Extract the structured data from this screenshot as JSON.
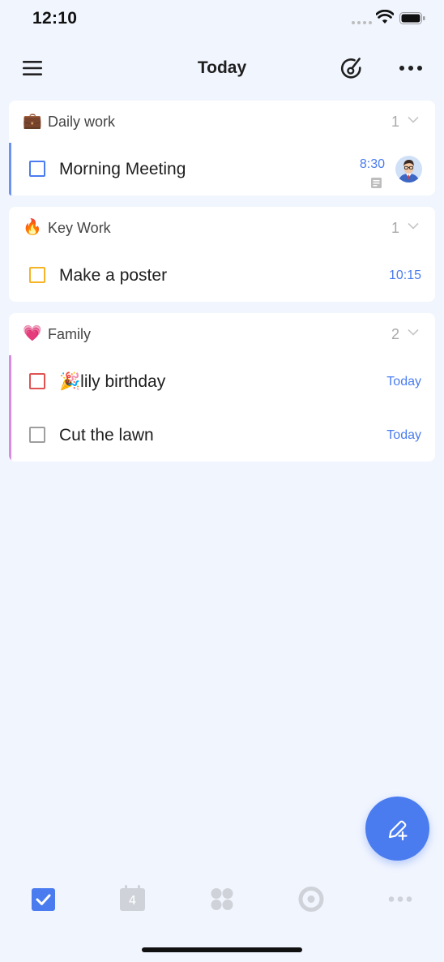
{
  "status_bar": {
    "time": "12:10"
  },
  "header": {
    "title": "Today"
  },
  "colors": {
    "accent": "#4a7cf0",
    "daily_bar": "#6e93ee",
    "key_checkbox": "#f5b325",
    "family_bar": "#d98be0",
    "family_checkbox_1": "#e05252",
    "family_checkbox_2": "#9e9e9e",
    "time_text": "#4a7cf0"
  },
  "lists": [
    {
      "emoji": "💼",
      "title": "Daily work",
      "count": "1",
      "tasks": [
        {
          "title": "Morning Meeting",
          "time": "8:30",
          "has_note": true,
          "has_avatar": true
        }
      ]
    },
    {
      "emoji": "🔥",
      "title": "Key Work",
      "count": "1",
      "tasks": [
        {
          "title": "Make a poster",
          "time": "10:15"
        }
      ]
    },
    {
      "emoji": "💗",
      "title": "Family",
      "count": "2",
      "tasks": [
        {
          "title": "🎉lily birthday",
          "time": "Today"
        },
        {
          "title": "Cut the lawn",
          "time": "Today"
        }
      ]
    }
  ],
  "fab": {
    "icon": "pen-plus-icon"
  },
  "tab_bar": {
    "tabs": [
      {
        "icon": "checkbox-icon",
        "active": true
      },
      {
        "icon": "calendar-icon",
        "calendar_day": "4"
      },
      {
        "icon": "grid-icon"
      },
      {
        "icon": "focus-icon"
      },
      {
        "icon": "more-dots-icon"
      }
    ]
  }
}
